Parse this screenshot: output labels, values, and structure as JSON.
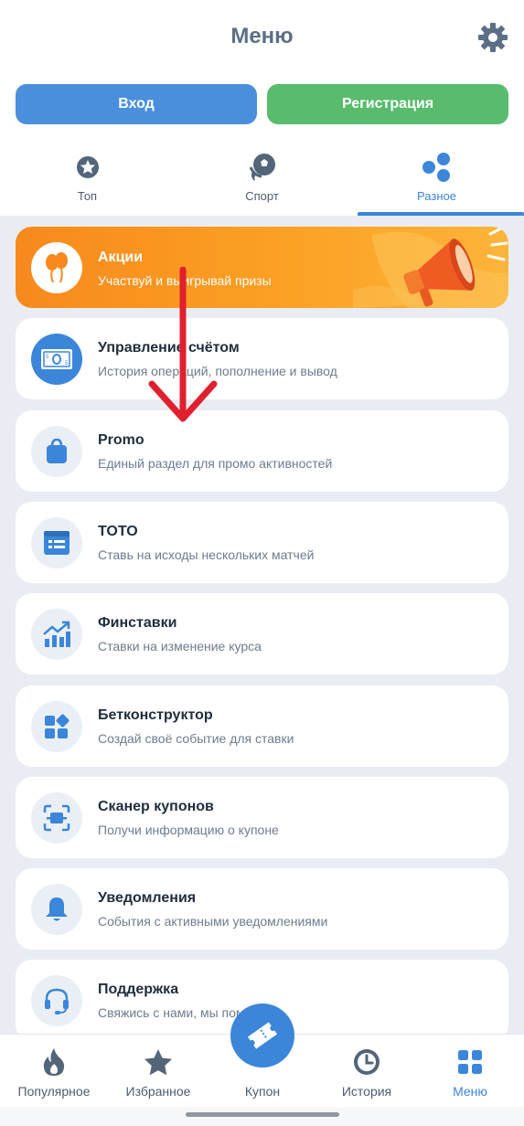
{
  "header": {
    "title": "Меню",
    "login_label": "Вход",
    "register_label": "Регистрация"
  },
  "tabs": [
    {
      "label": "Топ",
      "icon": "top-badge-icon",
      "active": false
    },
    {
      "label": "Спорт",
      "icon": "sport-ball-icon",
      "active": false
    },
    {
      "label": "Разное",
      "icon": "misc-dots-icon",
      "active": true
    }
  ],
  "banner": {
    "title": "Акции",
    "subtitle": "Участвуй и выигрывай призы",
    "icon": "balloons-icon"
  },
  "menu_items": [
    {
      "title": "Управление счётом",
      "subtitle": "История операций, пополнение и вывод",
      "icon": "money-icon"
    },
    {
      "title": "Promo",
      "subtitle": "Единый раздел для промо активностей",
      "icon": "shopping-bag-icon"
    },
    {
      "title": "ТОТО",
      "subtitle": "Ставь на исходы нескольких матчей",
      "icon": "toto-list-icon"
    },
    {
      "title": "Финставки",
      "subtitle": "Ставки на изменение курса",
      "icon": "chart-up-icon"
    },
    {
      "title": "Бетконструктор",
      "subtitle": "Создай своё событие для ставки",
      "icon": "blocks-icon"
    },
    {
      "title": "Сканер купонов",
      "subtitle": "Получи информацию о купоне",
      "icon": "scanner-icon"
    },
    {
      "title": "Уведомления",
      "subtitle": "События с активными уведомлениями",
      "icon": "bell-icon"
    },
    {
      "title": "Поддержка",
      "subtitle": "Свяжись с нами, мы поможем",
      "icon": "headset-icon"
    }
  ],
  "bottom_nav": [
    {
      "label": "Популярное",
      "icon": "flame-icon",
      "active": false
    },
    {
      "label": "Избранное",
      "icon": "star-icon",
      "active": false
    },
    {
      "label": "Купон",
      "icon": "coupon-ticket-icon",
      "active": false
    },
    {
      "label": "История",
      "icon": "clock-icon",
      "active": false
    },
    {
      "label": "Меню",
      "icon": "grid-menu-icon",
      "active": true
    }
  ],
  "colors": {
    "accent": "#3b86d9",
    "login_button": "#4a8fdc",
    "register_button": "#59bb6d",
    "banner_orange": "#f7891d",
    "annotation_arrow": "#e0202e"
  }
}
